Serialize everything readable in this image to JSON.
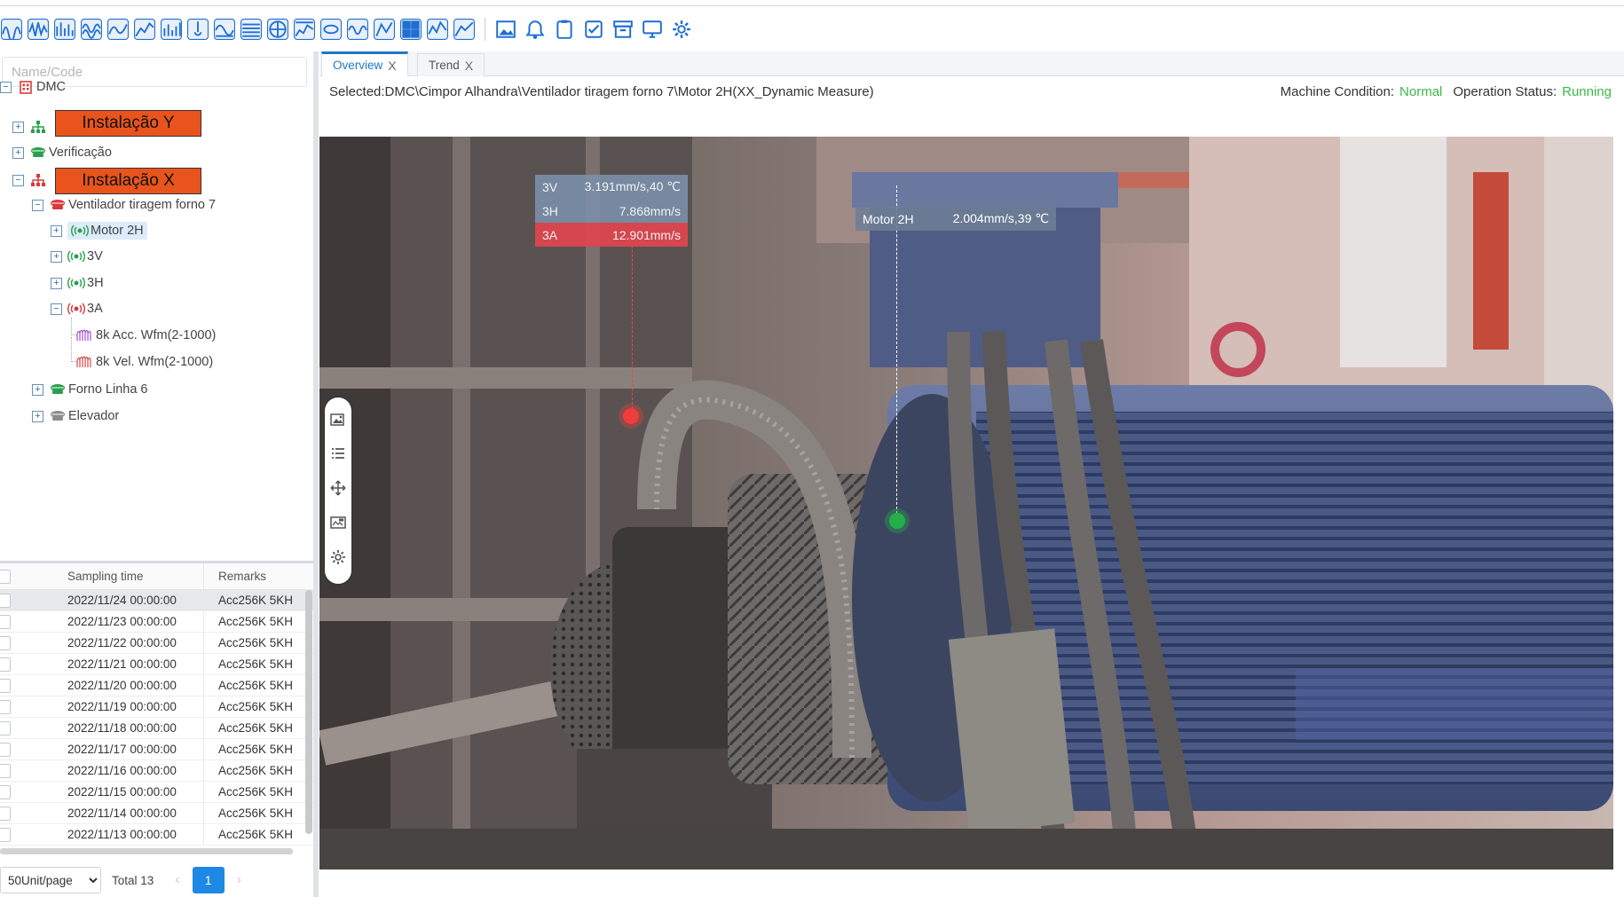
{
  "toolbar": {
    "colors": [
      "#1f6fd1",
      "#27a06a",
      "#e0a020",
      "#8f5bd6",
      "#d04040"
    ],
    "left_icons": [
      "waveform-icon",
      "waveform-icon",
      "spectrum-icon",
      "waveform-icon",
      "waveform-icon",
      "trend-icon",
      "bar-icon",
      "temperature-icon",
      "bode-icon",
      "waterfall-icon",
      "polar-icon",
      "cascade-icon",
      "orbit-icon",
      "envelope-icon",
      "phase-icon",
      "grid-icon",
      "spectrum-icon",
      "chart-icon"
    ],
    "right_icons": [
      "image-icon",
      "bell-icon",
      "clipboard-icon",
      "checklist-icon",
      "archive-icon",
      "monitor-icon",
      "gear-icon"
    ]
  },
  "sidebar": {
    "search_placeholder": "Name/Code",
    "tree": {
      "root": "DMC",
      "instalacao_y_label": "Instalação Y",
      "verificacao": "Verificação",
      "instalacao_x_label": "Instalação X",
      "ventilador": "Ventilador tiragem forno 7",
      "motor2h": "Motor 2H",
      "n3v": "3V",
      "n3h": "3H",
      "n3a": "3A",
      "wfm_acc": "8k Acc. Wfm(2-1000)",
      "wfm_vel": "8k Vel. Wfm(2-1000)",
      "forno": "Forno Linha 6",
      "elevador": "Elevador"
    }
  },
  "table": {
    "headers": {
      "time": "Sampling time",
      "remarks": "Remarks"
    },
    "rows": [
      {
        "time": "2022/11/24 00:00:00",
        "remarks": "Acc256K 5KH"
      },
      {
        "time": "2022/11/23 00:00:00",
        "remarks": "Acc256K 5KH"
      },
      {
        "time": "2022/11/22 00:00:00",
        "remarks": "Acc256K 5KH"
      },
      {
        "time": "2022/11/21 00:00:00",
        "remarks": "Acc256K 5KH"
      },
      {
        "time": "2022/11/20 00:00:00",
        "remarks": "Acc256K 5KH"
      },
      {
        "time": "2022/11/19 00:00:00",
        "remarks": "Acc256K 5KH"
      },
      {
        "time": "2022/11/18 00:00:00",
        "remarks": "Acc256K 5KH"
      },
      {
        "time": "2022/11/17 00:00:00",
        "remarks": "Acc256K 5KH"
      },
      {
        "time": "2022/11/16 00:00:00",
        "remarks": "Acc256K 5KH"
      },
      {
        "time": "2022/11/15 00:00:00",
        "remarks": "Acc256K 5KH"
      },
      {
        "time": "2022/11/14 00:00:00",
        "remarks": "Acc256K 5KH"
      },
      {
        "time": "2022/11/13 00:00:00",
        "remarks": "Acc256K 5KH"
      }
    ]
  },
  "pager": {
    "page_size": "50Unit/page",
    "total": "Total 13",
    "current_page": "1"
  },
  "tabs": {
    "overview": "Overview",
    "trend": "Trend",
    "close": "X"
  },
  "selection": {
    "text": "Selected:DMC\\Cimpor Alhandra\\Ventilador tiragem forno 7\\Motor 2H(XX_Dynamic Measure)"
  },
  "status": {
    "machine_label": "Machine Condition:",
    "machine_value": "Normal",
    "operation_label": "Operation Status:",
    "operation_value": "Running"
  },
  "tooltips": {
    "fan": [
      {
        "name": "3V",
        "value": "3.191mm/s,40 ℃",
        "color": "#7a8ea8"
      },
      {
        "name": "3H",
        "value": "7.868mm/s",
        "color": "#7a8ea8"
      },
      {
        "name": "3A",
        "value": "12.901mm/s",
        "color": "#e0454e"
      }
    ],
    "motor": {
      "name": "Motor 2H",
      "value": "2.004mm/s,39 ℃"
    }
  },
  "side_tools": [
    "image-icon",
    "list-icon",
    "move-icon",
    "picture-tag-icon",
    "gear-icon"
  ]
}
